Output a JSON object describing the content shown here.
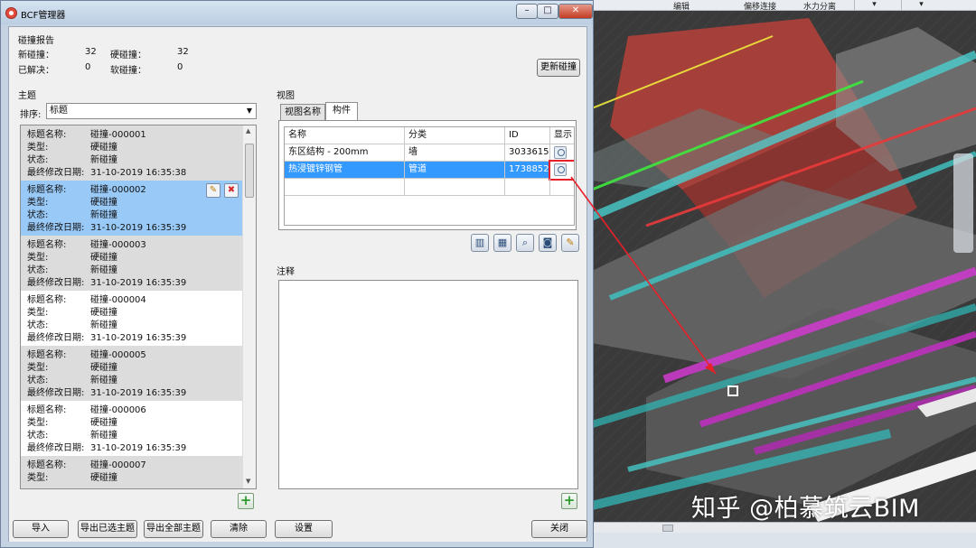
{
  "window": {
    "title": "BCF管理器",
    "minimize": "–",
    "maximize": "□",
    "close": "✕"
  },
  "report": {
    "heading": "碰撞报告",
    "new_label": "新碰撞：",
    "new_value": "32",
    "hard_label": "硬碰撞：",
    "hard_value": "32",
    "resolved_label": "已解决：",
    "resolved_value": "0",
    "soft_label": "软碰撞：",
    "soft_value": "0",
    "update_button": "更新碰撞"
  },
  "topics": {
    "heading": "主题",
    "sort_label": "排序:",
    "sort_value": "标题",
    "field_labels": {
      "name": "标题名称:",
      "type": "类型:",
      "status": "状态:",
      "modified": "最终修改日期:"
    },
    "items": [
      {
        "name": "碰撞-000001",
        "type": "硬碰撞",
        "status": "新碰撞",
        "modified": "31-10-2019 16:35:38"
      },
      {
        "name": "碰撞-000002",
        "type": "硬碰撞",
        "status": "新碰撞",
        "modified": "31-10-2019 16:35:39"
      },
      {
        "name": "碰撞-000003",
        "type": "硬碰撞",
        "status": "新碰撞",
        "modified": "31-10-2019 16:35:39"
      },
      {
        "name": "碰撞-000004",
        "type": "硬碰撞",
        "status": "新碰撞",
        "modified": "31-10-2019 16:35:39"
      },
      {
        "name": "碰撞-000005",
        "type": "硬碰撞",
        "status": "新碰撞",
        "modified": "31-10-2019 16:35:39"
      },
      {
        "name": "碰撞-000006",
        "type": "硬碰撞",
        "status": "新碰撞",
        "modified": "31-10-2019 16:35:39"
      },
      {
        "name": "碰撞-000007",
        "type": "硬碰撞",
        "status": "",
        "modified": ""
      }
    ],
    "add_button": "+"
  },
  "view": {
    "heading": "视图",
    "tabs": [
      "视图名称",
      "构件"
    ],
    "active_tab": "构件",
    "columns": [
      "名称",
      "分类",
      "ID",
      "显示"
    ],
    "rows": [
      {
        "name": "东区结构 - 200mm",
        "category": "墙",
        "id": "3033615"
      },
      {
        "name": "热浸镀锌钢管",
        "category": "管道",
        "id": "1738852"
      }
    ]
  },
  "comments": {
    "heading": "注释",
    "add_button": "+"
  },
  "footer": {
    "import": "导入",
    "export_selected": "导出已选主题",
    "export_all": "导出全部主题",
    "clear": "清除",
    "settings": "设置",
    "close": "关闭"
  },
  "viewport": {
    "toolbar_items": [
      "编辑",
      "偏移连接",
      "水力分离"
    ],
    "watermark": "知乎 @柏慕筑云BIM"
  },
  "colors": {
    "selected_row": "#3399ff",
    "selected_topic": "#99c9f7",
    "highlight_frame": "#e8202a"
  }
}
